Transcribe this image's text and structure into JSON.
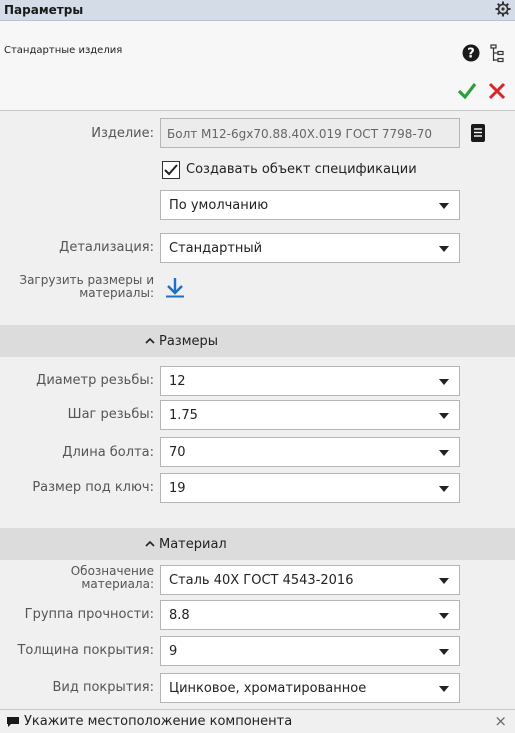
{
  "titlebar": {
    "title": "Параметры",
    "icon": "gear-icon"
  },
  "header": {
    "subtitle": "Стандартные изделия",
    "help_icon": "help-icon",
    "tree_icon": "tree-icon",
    "ok_icon": "checkmark-icon",
    "cancel_icon": "close-icon"
  },
  "main": {
    "product_label": "Изделие:",
    "product_value": "Болт М12-6gx70.88.40Х.019 ГОСТ 7798-70",
    "spec_checkbox_label": "Создавать объект спецификации",
    "spec_checked": true,
    "default_value": "По умолчанию",
    "detail_label": "Детализация:",
    "detail_value": "Стандартный",
    "load_label_line1": "Загрузить размеры и",
    "load_label_line2": "материалы:"
  },
  "sizes": {
    "title": "Размеры",
    "rows": [
      {
        "label": "Диаметр резьбы:",
        "value": "12"
      },
      {
        "label": "Шаг резьбы:",
        "value": "1.75"
      },
      {
        "label": "Длина болта:",
        "value": "70"
      },
      {
        "label": "Размер под ключ:",
        "value": "19"
      }
    ]
  },
  "material": {
    "title": "Материал",
    "designation_label_line1": "Обозначение",
    "designation_label_line2": "материала:",
    "designation_value": "Сталь 40Х ГОСТ 4543-2016",
    "rows": [
      {
        "label": "Группа прочности:",
        "value": "8.8"
      },
      {
        "label": "Толщина покрытия:",
        "value": "9"
      },
      {
        "label": "Вид покрытия:",
        "value": "Цинковое, хроматированное"
      }
    ]
  },
  "status": {
    "message": "Укажите местоположение компонента",
    "close": "×"
  },
  "colors": {
    "ok": "#2e9e3e",
    "cancel": "#d9262a",
    "load": "#1e6fc8",
    "section": "#dcdcdc"
  }
}
